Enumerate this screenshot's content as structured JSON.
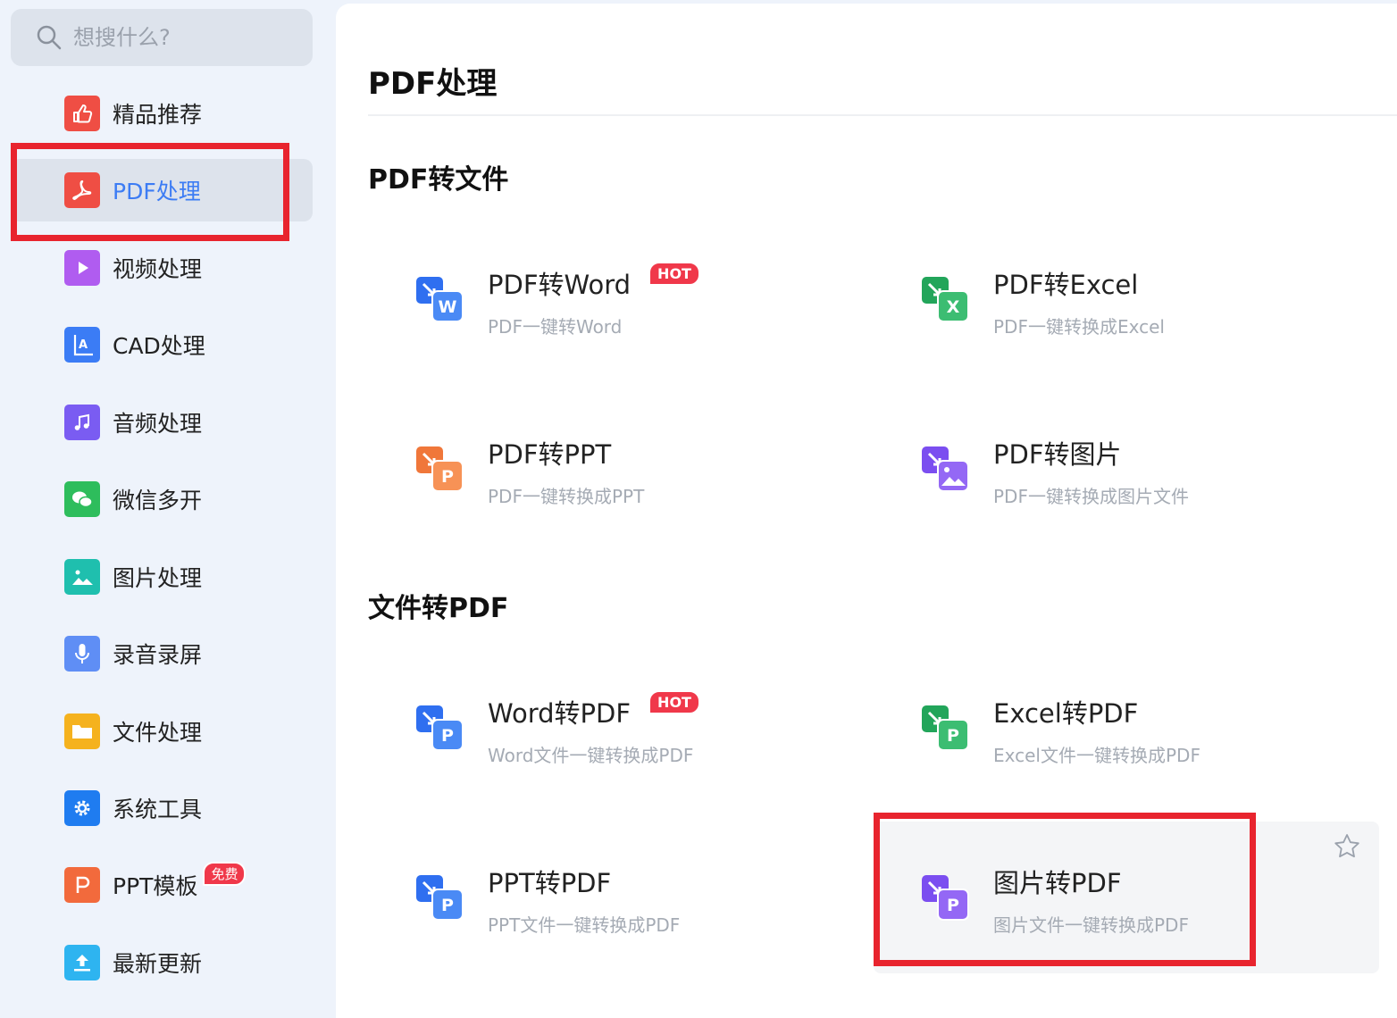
{
  "search": {
    "placeholder": "想搜什么?"
  },
  "sidebar": {
    "items": [
      {
        "label": "精品推荐",
        "icon": "thumbs-up-icon",
        "color": "#ef4e44"
      },
      {
        "label": "PDF处理",
        "icon": "pdf-icon",
        "color": "#ef4e44",
        "active": true
      },
      {
        "label": "视频处理",
        "icon": "play-icon",
        "color": "#b05cf0"
      },
      {
        "label": "CAD处理",
        "icon": "cad-icon",
        "color": "#3b7cf5"
      },
      {
        "label": "音频处理",
        "icon": "music-icon",
        "color": "#7a5cf2"
      },
      {
        "label": "微信多开",
        "icon": "wechat-icon",
        "color": "#2ebd5c"
      },
      {
        "label": "图片处理",
        "icon": "image-icon",
        "color": "#1fbfae"
      },
      {
        "label": "录音录屏",
        "icon": "microphone-icon",
        "color": "#5f8ef5"
      },
      {
        "label": "文件处理",
        "icon": "folder-icon",
        "color": "#f5b21e"
      },
      {
        "label": "系统工具",
        "icon": "gear-icon",
        "color": "#1f7cf0"
      },
      {
        "label": "PPT模板",
        "icon": "ppt-icon",
        "color": "#f26a3c",
        "badge": "免费"
      },
      {
        "label": "最新更新",
        "icon": "upload-icon",
        "color": "#2eb4f0"
      }
    ]
  },
  "main": {
    "title": "PDF处理",
    "sections": [
      {
        "title": "PDF转文件",
        "tools": [
          {
            "name": "PDF转Word",
            "desc": "PDF一键转Word",
            "badge": "HOT",
            "letter": "W",
            "color": "#2f6ff0"
          },
          {
            "name": "PDF转Excel",
            "desc": "PDF一键转换成Excel",
            "letter": "X",
            "color": "#22a55a"
          },
          {
            "name": "PDF转PPT",
            "desc": "PDF一键转换成PPT",
            "letter": "P",
            "color": "#f0773a"
          },
          {
            "name": "PDF转图片",
            "desc": "PDF一键转换成图片文件",
            "letter": "img",
            "color": "#7b4ef0"
          }
        ]
      },
      {
        "title": "文件转PDF",
        "tools": [
          {
            "name": "Word转PDF",
            "desc": "Word文件一键转换成PDF",
            "badge": "HOT",
            "letter": "P",
            "color": "#2f6ff0"
          },
          {
            "name": "Excel转PDF",
            "desc": "Excel文件一键转换成PDF",
            "letter": "P",
            "color": "#22a55a"
          },
          {
            "name": "PPT转PDF",
            "desc": "PPT文件一键转换成PDF",
            "letter": "P",
            "color": "#2f6ff0"
          },
          {
            "name": "图片转PDF",
            "desc": "图片文件一键转换成PDF",
            "letter": "P",
            "color": "#7b4ef0"
          }
        ]
      }
    ]
  },
  "colors": {
    "highlight": "#e8242e",
    "accent": "#3c7cf4",
    "hot_badge": "#f0384a"
  }
}
